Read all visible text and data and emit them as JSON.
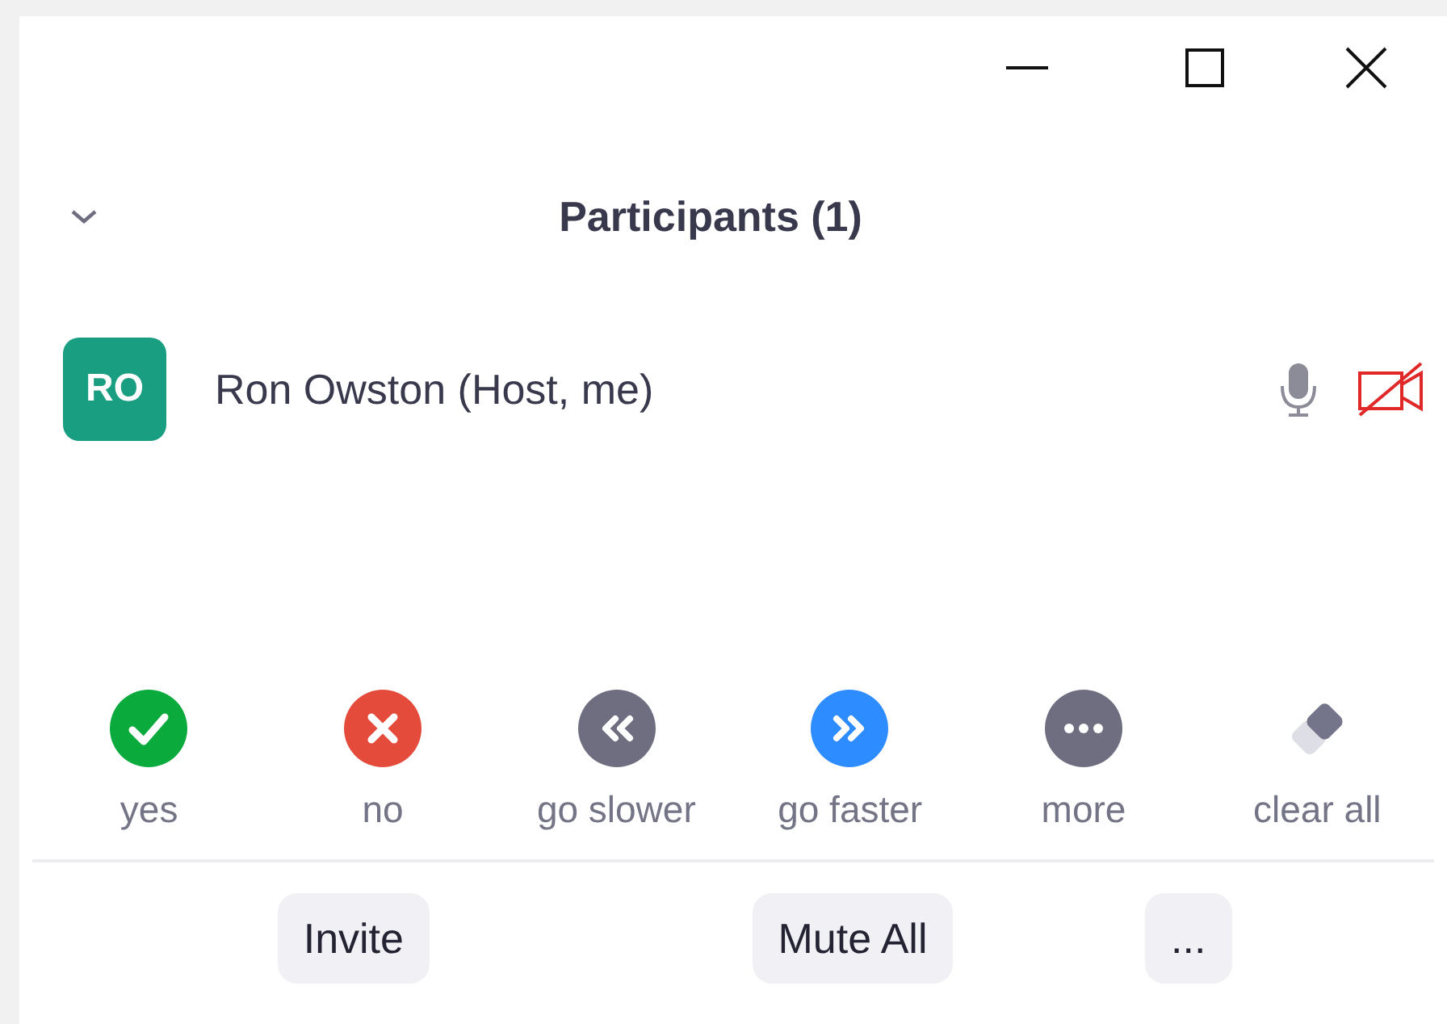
{
  "panel": {
    "title": "Participants (1)",
    "expanded": true
  },
  "participants": [
    {
      "initials": "RO",
      "name": "Ron Owston (Host, me)",
      "color": "#1a9e82",
      "audio_muted": false,
      "video_muted": true
    }
  ],
  "feedback": [
    {
      "kind": "yes",
      "label": "yes"
    },
    {
      "kind": "no",
      "label": "no"
    },
    {
      "kind": "slower",
      "label": "go slower"
    },
    {
      "kind": "faster",
      "label": "go faster"
    },
    {
      "kind": "more",
      "label": "more"
    },
    {
      "kind": "clear",
      "label": "clear all"
    }
  ],
  "buttons": [
    "Invite",
    "Mute All",
    "..."
  ]
}
